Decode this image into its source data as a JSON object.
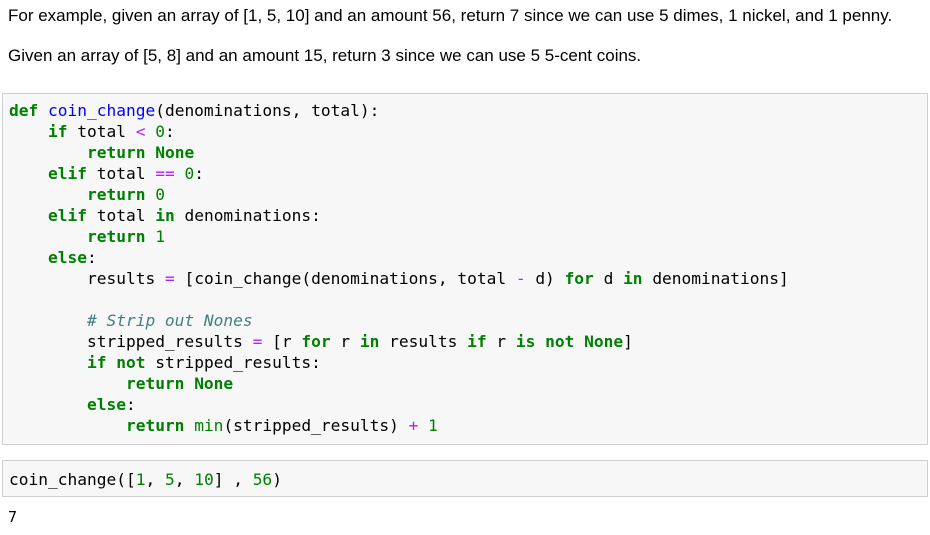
{
  "markdown": {
    "line1": "For example, given an array of [1, 5, 10] and an amount 56, return 7 since we can use 5 dimes, 1 nickel, and 1 penny.",
    "line2": "Given an array of [5, 8] and an amount 15, return 3 since we can use 5 5-cent coins."
  },
  "code_cell_1": {
    "tokens": {
      "def": "def",
      "fn_name": "coin_change",
      "params": "(denominations, total):",
      "if": "if",
      "total": "total",
      "lt": "<",
      "zero": "0",
      "colon": ":",
      "return": "return",
      "none": "None",
      "elif": "elif",
      "eqeq": "==",
      "in": "in",
      "denominations_colon": "denominations:",
      "one": "1",
      "else": "else",
      "results_assign": "results",
      "eq": "=",
      "list_open_call": "[coin_change(denominations, total",
      "minus": "-",
      "d_close": "d)",
      "for": "for",
      "d": "d",
      "denominations_close": "denominations]",
      "comment": "# Strip out Nones",
      "stripped_assign": "stripped_results",
      "r_open": "[r",
      "r": "r",
      "results": "results",
      "is": "is",
      "not": "not",
      "none_close": "None",
      "close_bracket": "]",
      "stripped_results_colon": "stripped_results:",
      "min": "min",
      "min_args": "(stripped_results)",
      "plus": "+"
    }
  },
  "code_cell_2": {
    "call_name": "coin_change",
    "open": "([",
    "n1": "1",
    "comma1": ", ",
    "n5": "5",
    "comma2": ", ",
    "n10": "10",
    "mid": "] , ",
    "n56": "56",
    "close": ")"
  },
  "output": {
    "value": "7"
  }
}
